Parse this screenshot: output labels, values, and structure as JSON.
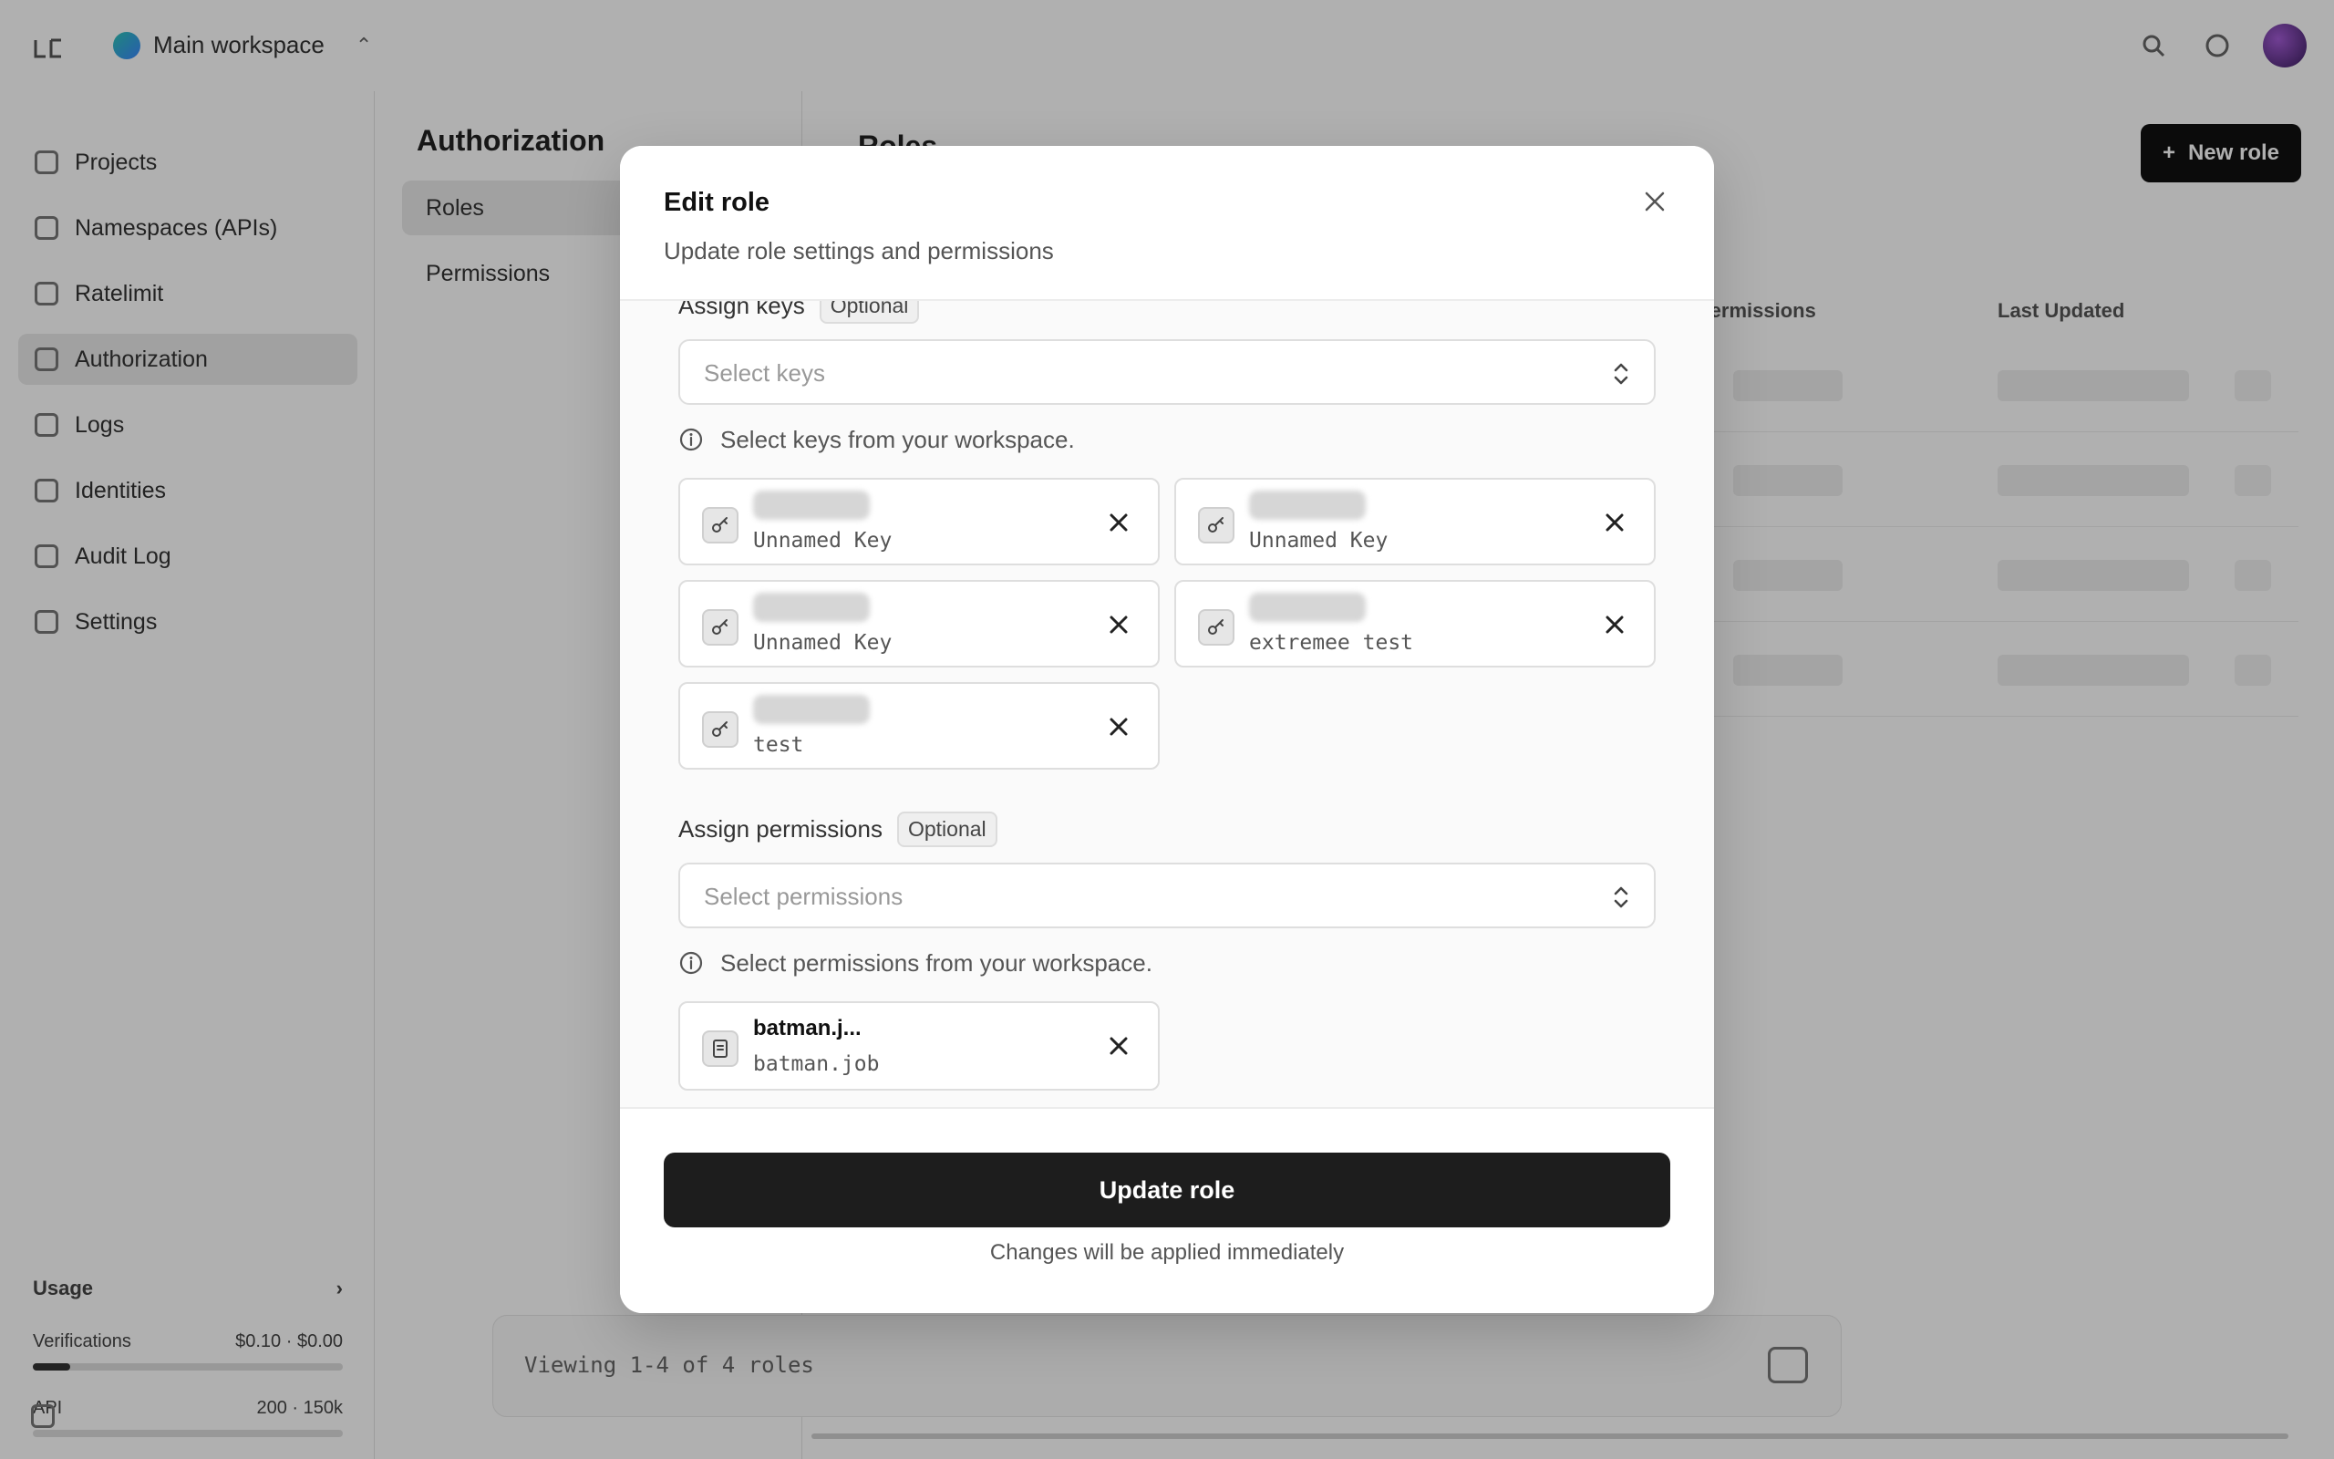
{
  "app": {
    "workspace_name": "Main workspace",
    "sidebar": {
      "items": [
        {
          "label": "Projects"
        },
        {
          "label": "Namespaces (APIs)"
        },
        {
          "label": "Ratelimit"
        },
        {
          "label": "Authorization"
        },
        {
          "label": "Logs"
        },
        {
          "label": "Identities"
        },
        {
          "label": "Audit Log"
        },
        {
          "label": "Settings"
        }
      ],
      "active_index": 3,
      "usage": {
        "title": "Usage",
        "row1_label": "Verifications",
        "row1_value": "$0.10 · $0.00",
        "row2_label": "API",
        "row2_value": "200 · 150k"
      }
    },
    "subnav": {
      "title": "Authorization",
      "items": [
        {
          "label": "Roles"
        },
        {
          "label": "Permissions"
        }
      ]
    },
    "main": {
      "title": "Roles",
      "new_button": "New role",
      "columns": [
        "Permissions",
        "Last Updated"
      ]
    },
    "bottombar": {
      "text": "Viewing 1-4 of 4 roles"
    }
  },
  "modal": {
    "title": "Edit role",
    "subtitle": "Update role settings and permissions",
    "keys": {
      "label": "Assign keys",
      "optional": "Optional",
      "placeholder": "Select keys",
      "hint": "Select keys from your workspace.",
      "items": [
        {
          "name": "Unnamed Key"
        },
        {
          "name": "Unnamed Key"
        },
        {
          "name": "Unnamed Key"
        },
        {
          "name": "extremee test"
        },
        {
          "name": "test"
        }
      ]
    },
    "permissions": {
      "label": "Assign permissions",
      "optional": "Optional",
      "placeholder": "Select permissions",
      "hint": "Select permissions from your workspace.",
      "items": [
        {
          "title": "batman.j...",
          "name": "batman.job"
        }
      ]
    },
    "submit_label": "Update role",
    "footer_note": "Changes will be applied immediately"
  },
  "colors": {
    "overlay": "#000000",
    "primary_button": "#1d1d1d",
    "modal_body_bg": "#fafafa"
  }
}
